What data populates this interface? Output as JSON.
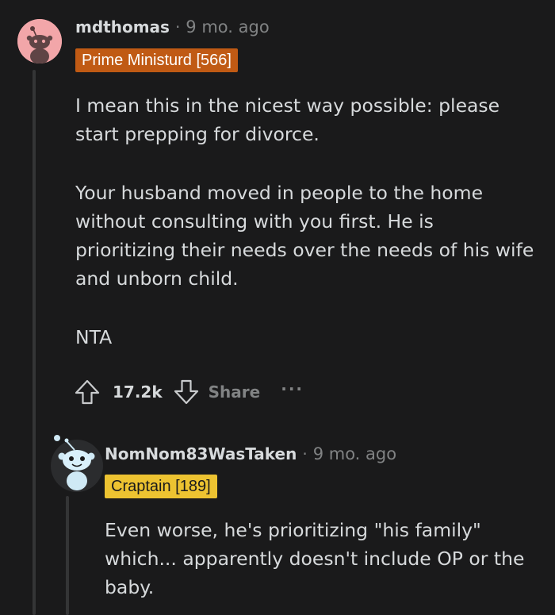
{
  "comments": [
    {
      "username": "mdthomas",
      "separator": "·",
      "time": "9 mo. ago",
      "flair": "Prime Ministurd [566]",
      "flair_bg": "#c05a14",
      "flair_fg": "#ffffff",
      "avatar": "snoo-pink-avatar-icon",
      "paragraphs": [
        "I mean this in the nicest way possible: please start prepping for divorce.",
        "Your husband moved in people to the home without consulting with you first. He is prioritizing their needs over the needs of his wife and unborn child.",
        "NTA"
      ],
      "votes": "17.2k",
      "share_label": "Share",
      "more_label": "···"
    },
    {
      "username": "NomNom83WasTaken",
      "separator": "·",
      "time": "9 mo. ago",
      "flair": "Craptain [189]",
      "flair_bg": "#edc331",
      "flair_fg": "#1a1a1b",
      "avatar": "snoo-blue-avatar-icon",
      "paragraphs": [
        "Even worse, he's prioritizing \"his family\" which... apparently doesn't include OP or the baby."
      ]
    }
  ],
  "colors": {
    "background": "#1a1a1b",
    "text": "#d7dadc",
    "muted": "#818384",
    "thread_line": "#343536"
  }
}
